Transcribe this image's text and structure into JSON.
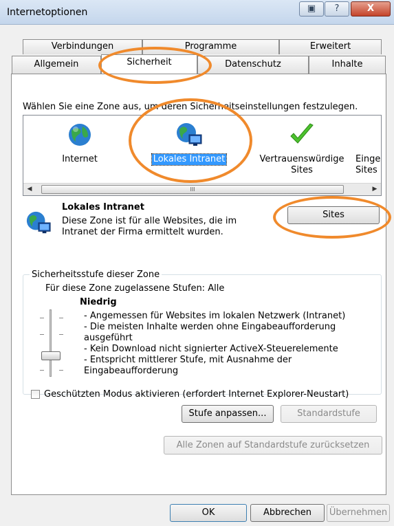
{
  "window": {
    "title": "Internetoptionen",
    "close_glyph": "X",
    "help_glyph": "?"
  },
  "tabs": {
    "row1": [
      "Verbindungen",
      "Programme",
      "Erweitert"
    ],
    "row2": [
      "Allgemein",
      "Sicherheit",
      "Datenschutz",
      "Inhalte"
    ],
    "active": "Sicherheit"
  },
  "security": {
    "intro": "Wählen Sie eine Zone aus, um deren Sicherheitseinstellungen festzulegen.",
    "zones": [
      {
        "label": "Internet",
        "icon": "globe-icon"
      },
      {
        "label": "Lokales Intranet",
        "icon": "intranet-globe-icon",
        "selected": true
      },
      {
        "label": "Vertrauenswürdige Sites",
        "icon": "checkmark-icon"
      },
      {
        "label": "Eingeschränkte Sites",
        "icon": "restricted-icon"
      }
    ],
    "scroll_thumb_glyph": "III",
    "selected_zone": {
      "title": "Lokales Intranet",
      "description": "Diese Zone ist für alle Websites, die im Intranet der Firma ermittelt wurden.",
      "sites_button": "Sites"
    },
    "level_group": {
      "legend": "Sicherheitsstufe dieser Zone",
      "allowed": "Für diese Zone zugelassene Stufen: Alle",
      "level_name": "Niedrig",
      "bullets": [
        "- Angemessen für Websites im lokalen Netzwerk (Intranet)",
        "- Die meisten Inhalte werden ohne Eingabeaufforderung",
        "ausgeführt",
        "- Kein Download nicht signierter ActiveX-Steuerelemente",
        "- Entspricht mittlerer Stufe, mit Ausnahme der",
        "Eingabeaufforderung"
      ],
      "protected_mode_label": "Geschützten Modus aktivieren (erfordert Internet Explorer-Neustart)",
      "protected_mode_checked": false,
      "custom_level_button": "Stufe anpassen...",
      "default_level_button": "Standardstufe"
    },
    "reset_all_button": "Alle Zonen auf Standardstufe zurücksetzen"
  },
  "footer": {
    "ok": "OK",
    "cancel": "Abbrechen",
    "apply": "Übernehmen"
  },
  "colors": {
    "annotation": "#f08a2c",
    "selection": "#3399ff"
  }
}
